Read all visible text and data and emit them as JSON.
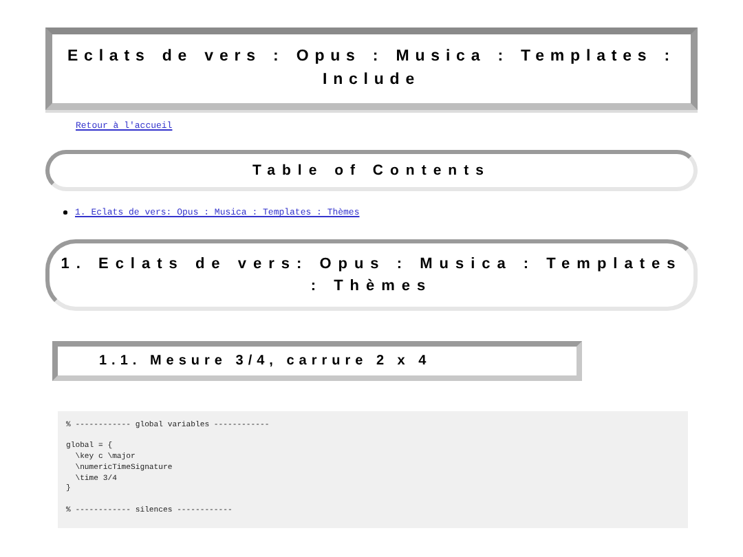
{
  "page_title": "Eclats de vers : Opus : Musica : Templates : Include",
  "home_link": "Retour à l'accueil",
  "toc": {
    "title": "Table of Contents",
    "items": [
      "1. Eclats de vers: Opus : Musica : Templates : Thèmes"
    ]
  },
  "section": {
    "title": "1. Eclats de vers: Opus : Musica : Templates : Thèmes"
  },
  "subsection": {
    "title": "1.1. Mesure 3/4, carrure 2 x 4"
  },
  "code": "% ------------ global variables ------------\n\nglobal = {\n  \\key c \\major\n  \\numericTimeSignature\n  \\time 3/4\n}\n\n% ------------ silences ------------"
}
